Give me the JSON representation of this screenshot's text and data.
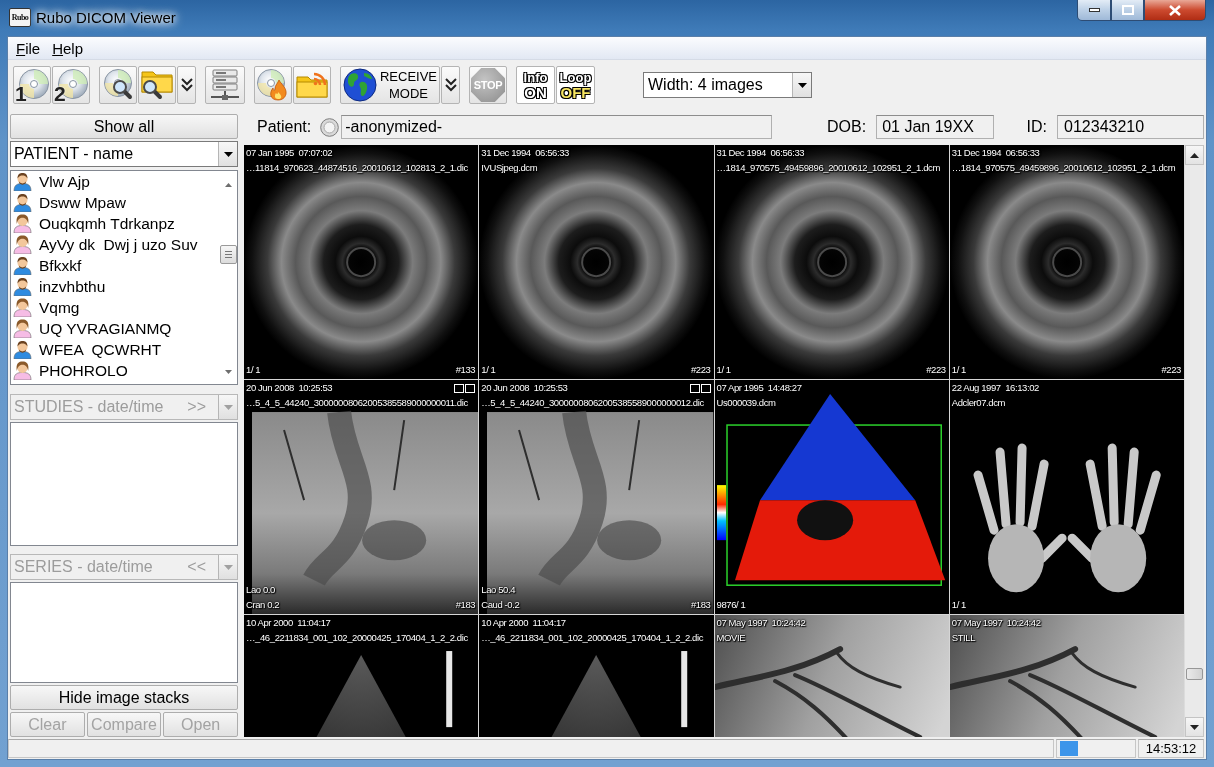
{
  "window": {
    "title": "Rubo DICOM Viewer",
    "logo": "Rubo"
  },
  "menu": [
    {
      "label": "File"
    },
    {
      "label": "Help"
    }
  ],
  "toolbar": {
    "groups": [
      [
        {
          "kind": "disc",
          "label": "1"
        },
        {
          "kind": "disc",
          "label": "2"
        }
      ],
      [
        {
          "kind": "disc-search"
        },
        {
          "kind": "folder-search"
        },
        {
          "kind": "more"
        }
      ],
      [
        {
          "kind": "server"
        }
      ],
      [
        {
          "kind": "disc-burn"
        },
        {
          "kind": "folder-feed"
        }
      ],
      [
        {
          "kind": "receive",
          "lines": [
            "RECEIVE",
            "MODE"
          ]
        },
        {
          "kind": "more"
        }
      ],
      [
        {
          "kind": "stop",
          "label": "STOP"
        }
      ],
      [
        {
          "kind": "info",
          "lines": [
            "Info",
            "ON"
          ]
        },
        {
          "kind": "loop",
          "lines": [
            "Loop",
            "OFF"
          ]
        }
      ]
    ],
    "width_select": {
      "value": "Width: 4 images"
    }
  },
  "left_panel": {
    "show_all": "Show all",
    "patient_select": {
      "value": "PATIENT - name",
      "disabled": false
    },
    "patients": [
      {
        "name": "Vlw Ajp",
        "kind": "male"
      },
      {
        "name": "Dsww Mpaw",
        "kind": "male"
      },
      {
        "name": "Ouqkqmh Tdrkanpz",
        "kind": "female"
      },
      {
        "name": "AyVy dk  Dwj j uzo Suv",
        "kind": "female"
      },
      {
        "name": "Bfkxkf",
        "kind": "male"
      },
      {
        "name": "inzvhbthu",
        "kind": "male"
      },
      {
        "name": "Vqmg",
        "kind": "female"
      },
      {
        "name": "UQ YVRAGIANMQ",
        "kind": "female"
      },
      {
        "name": "WFEA  QCWRHT",
        "kind": "male"
      },
      {
        "name": "PHOHROLO",
        "kind": "female"
      }
    ],
    "studies_select": {
      "value": "STUDIES - date/time",
      "toggle": ">>",
      "disabled": true
    },
    "series_select": {
      "value": "SERIES - date/time",
      "toggle": "<<",
      "disabled": true
    },
    "hide_stacks": "Hide image stacks",
    "buttons": [
      {
        "label": "Clear",
        "disabled": true
      },
      {
        "label": "Compare",
        "disabled": true
      },
      {
        "label": "Open",
        "disabled": true
      }
    ]
  },
  "patient_bar": {
    "patient_label": "Patient:",
    "patient": "-anonymized-",
    "dob_label": "DOB:",
    "dob": "01 Jan 19XX",
    "id_label": "ID:",
    "id": "012343210"
  },
  "tiles": [
    {
      "kind": "ring",
      "date": "07 Jan 1995  07:07:02",
      "name": "…11814_970623_44874516_20010612_102813_2_1.dic",
      "bottom_left": [
        "1/ 1"
      ],
      "number": "#133",
      "stack_marker": false
    },
    {
      "kind": "ring",
      "date": "31 Dec 1994  06:56:33",
      "name": "IVUSjpeg.dcm",
      "bottom_left": [
        "1/ 1"
      ],
      "number": "#223",
      "stack_marker": false
    },
    {
      "kind": "ring",
      "date": "31 Dec 1994  06:56:33",
      "name": "…1814_970575_49459896_20010612_102951_2_1.dcm",
      "bottom_left": [
        "1/ 1"
      ],
      "number": "#223",
      "stack_marker": false
    },
    {
      "kind": "ring",
      "date": "31 Dec 1994  06:56:33",
      "name": "…1814_970575_49459896_20010612_102951_2_1.dcm",
      "bottom_left": [
        "1/ 1"
      ],
      "number": "#223",
      "stack_marker": false
    },
    {
      "kind": "xray",
      "date": "20 Jun 2008  10:25:53",
      "name": "…5_4_5_44240_30000008062005385589000000011.dic",
      "bottom_left": [
        "Lao 0.0",
        "Cran 0.2"
      ],
      "number": "#183",
      "stack_marker": true
    },
    {
      "kind": "xray",
      "date": "20 Jun 2008  10:25:53",
      "name": "…5_4_5_44240_30000008062005385589000000012.dic",
      "bottom_left": [
        "Lao 50.4",
        "Caud -0.2"
      ],
      "number": "#183",
      "stack_marker": true
    },
    {
      "kind": "doppler",
      "date": "07 Apr 1995  14:48:27",
      "name": "Us000039.dcm",
      "bottom_left": [
        "9876/ 1"
      ],
      "stack_marker": false
    },
    {
      "kind": "hands",
      "date": "22 Aug 1997  16:13:02",
      "name": "Adcler07.dcm",
      "bottom_left": [
        "1/ 1"
      ],
      "stack_marker": false
    },
    {
      "kind": "sector",
      "date": "10 Apr 2000  11:04:17",
      "name": "…_46_2211834_001_102_20000425_170404_1_2_2.dic",
      "stack_marker": false
    },
    {
      "kind": "sector",
      "date": "10 Apr 2000  11:04:17",
      "name": "…_46_2211834_001_102_20000425_170404_1_2_2.dic",
      "stack_marker": false
    },
    {
      "kind": "vessels",
      "date": "07 May 1997  10:24:42",
      "name": "MOVIE",
      "stack_marker": false
    },
    {
      "kind": "vessels",
      "date": "07 May 1997  10:24:42",
      "name": "STILL",
      "stack_marker": false
    }
  ],
  "status_bar": {
    "time": "14:53:12"
  }
}
